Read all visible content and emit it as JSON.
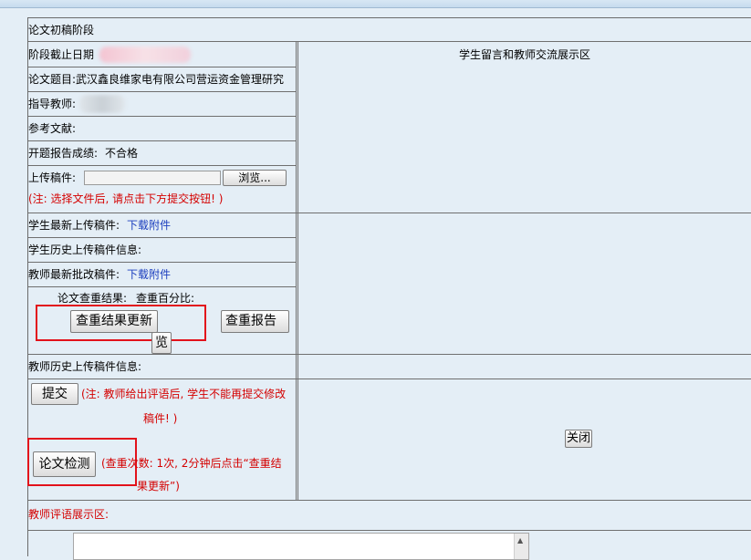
{
  "section_title": "论文初稿阶段",
  "deadline_label": "阶段截止日期",
  "exchange_area_title": "学生留言和教师交流展示区",
  "thesis_title_label": "论文题目:",
  "thesis_title_value": "武汉鑫良维家电有限公司营运资金管理研究",
  "advisor_label": "指导教师:",
  "references_label": "参考文献:",
  "proposal_score_label": "开题报告成绩:",
  "proposal_score_value": "不合格",
  "upload_label": "上传稿件:",
  "browse_button": "浏览...",
  "upload_note": "(注: 选择文件后, 请点击下方提交按钮! )",
  "student_latest_label": "学生最新上传稿件:",
  "student_latest_link": "下载附件",
  "student_history_label": "学生历史上传稿件信息:",
  "teacher_latest_label": "教师最新批改稿件:",
  "teacher_latest_link": "下载附件",
  "check_result_label": "论文查重结果:",
  "check_percent_label": "查重百分比:",
  "update_check_button": "查重结果更新",
  "preview_report_button": "查重报告预",
  "preview_report_button_tail": "览",
  "teacher_history_label": "教师历史上传稿件信息:",
  "submit_button": "提交",
  "submit_note_line1": "(注: 教师给出评语后, 学生不能再提交修改",
  "submit_note_line2": "稿件! )",
  "detect_button": "论文检测",
  "detect_note_line1": "(查重次数: 1次, 2分钟后点击“查重结",
  "detect_note_line2": "果更新”)",
  "close_button": "关闭",
  "comment_area_label": "教师评语展示区:",
  "colors": {
    "background": "#e4eef6",
    "accent_red": "#d40000",
    "link_blue": "#1c3fbe",
    "highlight_box": "#e2121b"
  }
}
